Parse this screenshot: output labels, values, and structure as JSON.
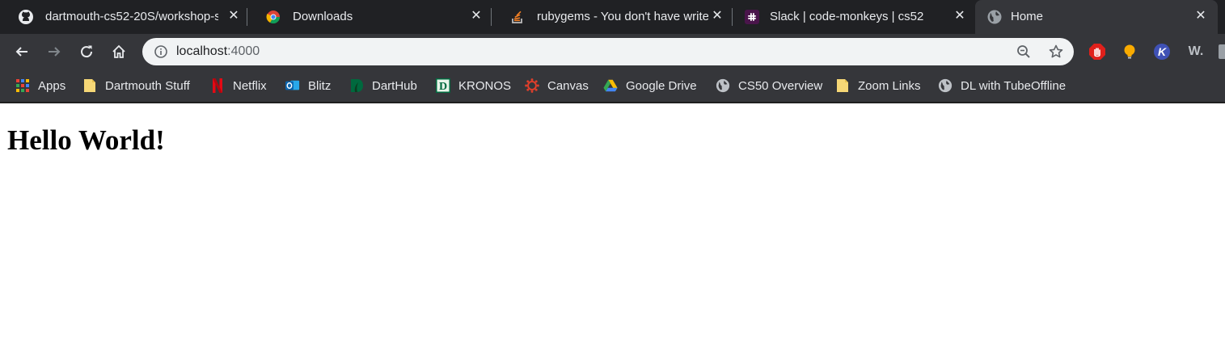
{
  "tabs": [
    {
      "title": "dartmouth-cs52-20S/workshop-s",
      "icon": "github-icon"
    },
    {
      "title": "Downloads",
      "icon": "chrome-downloads-icon"
    },
    {
      "title": "rubygems - You don't have write",
      "icon": "stackoverflow-icon"
    },
    {
      "title": "Slack | code-monkeys | cs52",
      "icon": "slack-icon"
    },
    {
      "title": "Home",
      "icon": "globe-icon"
    }
  ],
  "omnibox": {
    "host": "localhost",
    "port": ":4000"
  },
  "extensions": [
    {
      "name": "adblock-icon",
      "label": ""
    },
    {
      "name": "lightbulb-icon",
      "label": ""
    },
    {
      "name": "k-extension-icon",
      "label": "K"
    },
    {
      "name": "w-extension-icon",
      "label": "W."
    }
  ],
  "bookmarks": [
    {
      "label": "Apps",
      "icon": "apps-grid-icon"
    },
    {
      "label": "Dartmouth Stuff",
      "icon": "folder-icon"
    },
    {
      "label": "Netflix",
      "icon": "netflix-icon"
    },
    {
      "label": "Blitz",
      "icon": "outlook-icon"
    },
    {
      "label": "DartHub",
      "icon": "darthub-icon"
    },
    {
      "label": "KRONOS",
      "icon": "kronos-icon"
    },
    {
      "label": "Canvas",
      "icon": "canvas-icon"
    },
    {
      "label": "Google Drive",
      "icon": "google-drive-icon"
    },
    {
      "label": "CS50 Overview",
      "icon": "globe-icon"
    },
    {
      "label": "Zoom Links",
      "icon": "folder-icon"
    },
    {
      "label": "DL with TubeOffline",
      "icon": "globe-icon"
    }
  ],
  "page": {
    "heading": "Hello World!"
  },
  "colors": {
    "chrome_dark": "#202124",
    "toolbar": "#35363a",
    "omnibox_bg": "#f1f3f4",
    "text_light": "#e8eaed"
  }
}
